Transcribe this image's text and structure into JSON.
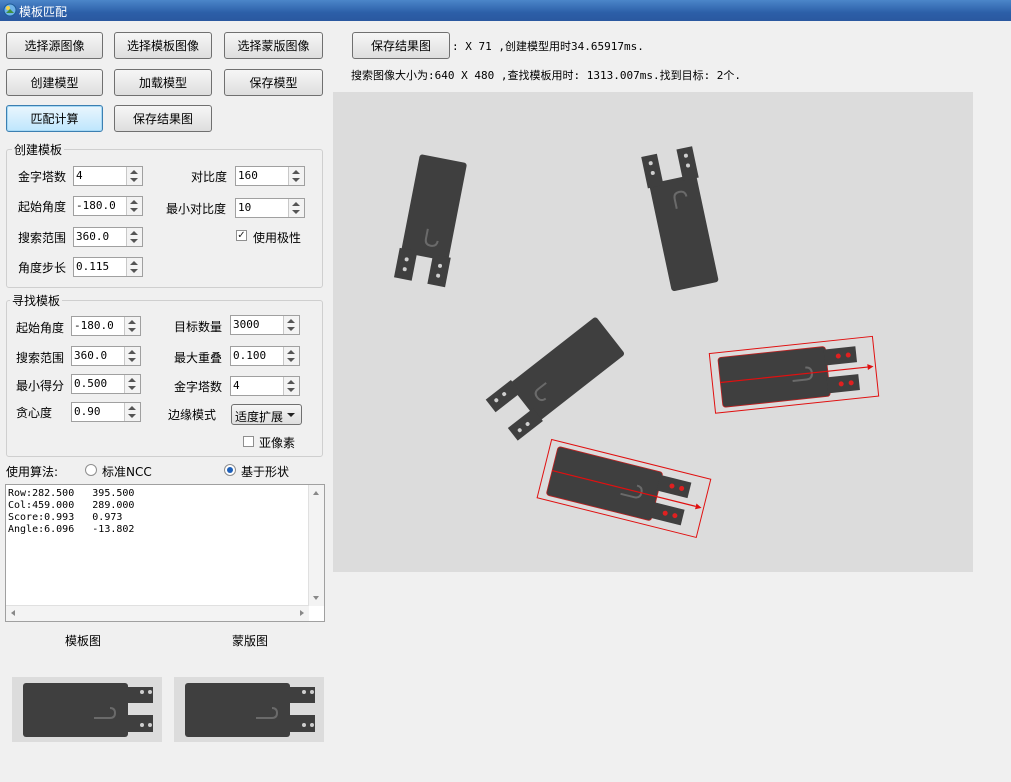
{
  "window": {
    "title": "模板匹配"
  },
  "buttons": {
    "select_source": "选择源图像",
    "select_template": "选择模板图像",
    "select_mask": "选择蒙版图像",
    "create_model": "创建模型",
    "load_model": "加载模型",
    "save_model": "保存模型",
    "match_compute": "匹配计算",
    "save_result_left": "保存结果图",
    "save_result_top": "保存结果图"
  },
  "status": {
    "line1": ": X 71 ,创建模型用时34.65917ms.",
    "line2": "搜索图像大小为:640 X 480 ,查找模板用时: 1313.007ms.找到目标: 2个."
  },
  "create_group": {
    "title": "创建模板",
    "pyramid_label": "金字塔数",
    "pyramid_value": "4",
    "contrast_label": "对比度",
    "contrast_value": "160",
    "start_angle_label": "起始角度",
    "start_angle_value": "-180.0",
    "min_contrast_label": "最小对比度",
    "min_contrast_value": "10",
    "search_range_label": "搜索范围",
    "search_range_value": "360.0",
    "polarity_label": "使用极性",
    "polarity_checked": true,
    "angle_step_label": "角度步长",
    "angle_step_value": "0.115"
  },
  "find_group": {
    "title": "寻找模板",
    "start_angle_label": "起始角度",
    "start_angle_value": "-180.0",
    "target_count_label": "目标数量",
    "target_count_value": "3000",
    "search_range_label": "搜索范围",
    "search_range_value": "360.0",
    "max_overlap_label": "最大重叠",
    "max_overlap_value": "0.100",
    "min_score_label": "最小得分",
    "min_score_value": "0.500",
    "pyramid_label": "金字塔数",
    "pyramid_value": "4",
    "greedy_label": "贪心度",
    "greedy_value": "0.90",
    "edge_mode_label": "边缘模式",
    "edge_mode_value": "适度扩展",
    "subpixel_label": "亚像素",
    "subpixel_checked": false
  },
  "algorithm": {
    "label": "使用算法:",
    "ncc_label": "标准NCC",
    "shape_label": "基于形状",
    "selected": "shape"
  },
  "results_text": "Row:282.500   395.500\nCol:459.000   289.000\nScore:0.993   0.973\nAngle:6.096   -13.802",
  "previews": {
    "template_label": "模板图",
    "mask_label": "蒙版图"
  },
  "colors": {
    "accent": "#1e5fb8",
    "match_box": "#e01010",
    "part": "#3f3f3f",
    "canvas_bg": "#dcdcdc"
  }
}
